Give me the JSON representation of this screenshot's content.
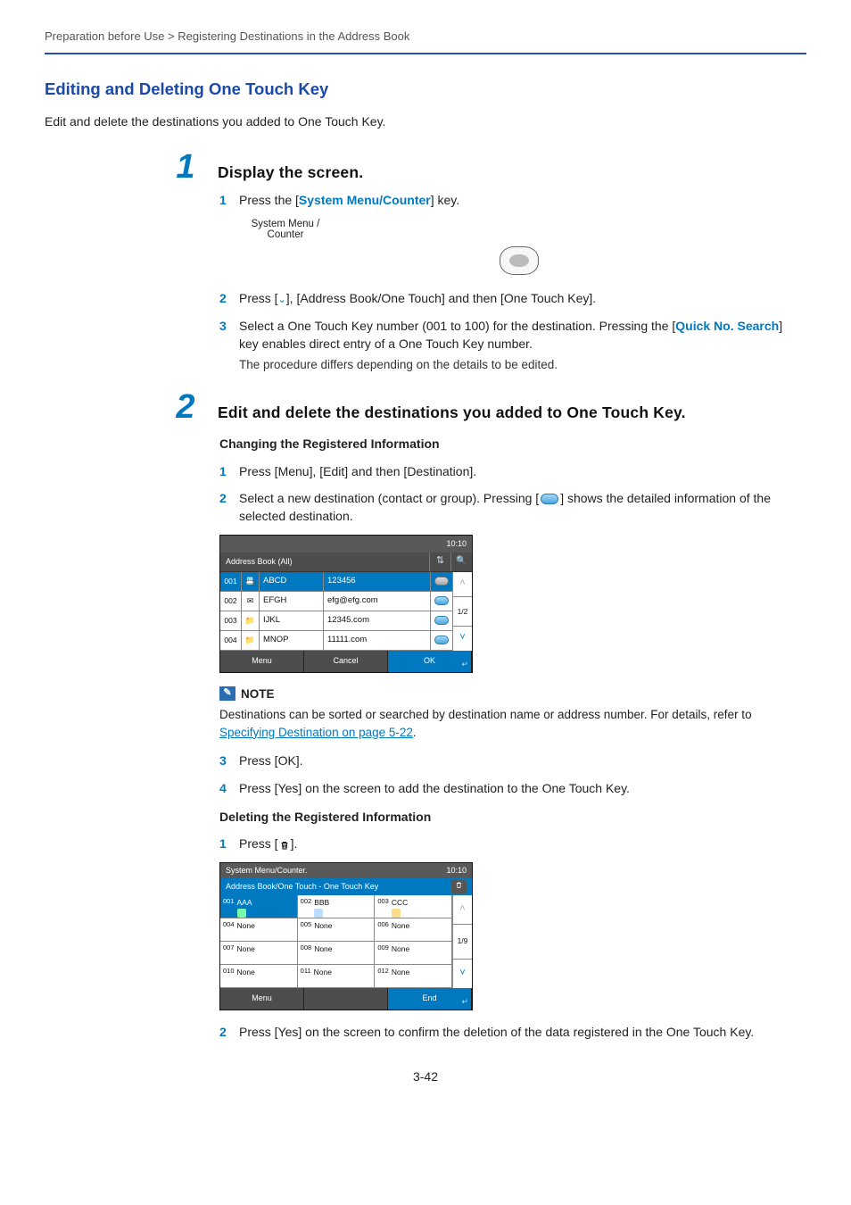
{
  "breadcrumb": "Preparation before Use > Registering Destinations in the Address Book",
  "heading": "Editing and Deleting One Touch Key",
  "intro": "Edit and delete the destinations you added to One Touch Key.",
  "page_number": "3-42",
  "step1": {
    "num": "1",
    "title": "Display the screen.",
    "s1": {
      "num": "1",
      "pre": "Press the [",
      "link": "System Menu/Counter",
      "post": "] key."
    },
    "sysmenu_l1": "System Menu /",
    "sysmenu_l2": "Counter",
    "s2": {
      "num": "2",
      "text_pre": "Press [",
      "text_post": "], [Address Book/One Touch] and then [One Touch Key]."
    },
    "s3": {
      "num": "3",
      "pre": "Select a One Touch Key number (001 to 100) for the destination. Pressing the [",
      "link": "Quick No. Search",
      "post": "] key enables direct entry of a One Touch Key number.",
      "sub": "The procedure differs depending on the details to be edited."
    }
  },
  "step2": {
    "num": "2",
    "title": "Edit and delete the destinations you added to One Touch Key.",
    "sub1": "Changing the Registered Information",
    "c1": {
      "num": "1",
      "text": "Press [Menu], [Edit] and then [Destination]."
    },
    "c2": {
      "num": "2",
      "pre": "Select a new destination (contact or group). Pressing [",
      "post": "] shows the detailed information of the selected destination."
    },
    "screenA": {
      "time": "10:10",
      "title": "Address Book (All)",
      "rows": [
        {
          "idx": "001",
          "name": "ABCD",
          "val": "123456",
          "sel": true
        },
        {
          "idx": "002",
          "name": "EFGH",
          "val": "efg@efg.com",
          "sel": false
        },
        {
          "idx": "003",
          "name": "IJKL",
          "val": "12345.com",
          "sel": false
        },
        {
          "idx": "004",
          "name": "MNOP",
          "val": "11111.com",
          "sel": false
        }
      ],
      "counter": "1/2",
      "menu": "Menu",
      "cancel": "Cancel",
      "ok": "OK"
    },
    "note": {
      "label": "NOTE",
      "pre": "Destinations can be sorted or searched by destination name or address number. For details, refer to ",
      "link": "Specifying Destination on page 5-22",
      "post": "."
    },
    "c3": {
      "num": "3",
      "text": "Press [OK]."
    },
    "c4": {
      "num": "4",
      "text": "Press [Yes] on the screen to add the destination to the One Touch Key."
    },
    "sub2": "Deleting the Registered Information",
    "d1": {
      "num": "1",
      "pre": "Press [",
      "post": "]."
    },
    "screenB": {
      "time": "10:10",
      "crumb": "System Menu/Counter.",
      "title": "Address Book/One Touch - One Touch Key",
      "cells": [
        [
          {
            "idx": "001",
            "text": "AAA",
            "sel": true,
            "icon": "contact"
          },
          {
            "idx": "002",
            "text": "BBB",
            "icon": "group"
          },
          {
            "idx": "003",
            "text": "CCC",
            "icon": "folder"
          }
        ],
        [
          {
            "idx": "004",
            "text": "None"
          },
          {
            "idx": "005",
            "text": "None"
          },
          {
            "idx": "006",
            "text": "None"
          }
        ],
        [
          {
            "idx": "007",
            "text": "None"
          },
          {
            "idx": "008",
            "text": "None"
          },
          {
            "idx": "009",
            "text": "None"
          }
        ],
        [
          {
            "idx": "010",
            "text": "None"
          },
          {
            "idx": "011",
            "text": "None"
          },
          {
            "idx": "012",
            "text": "None"
          }
        ]
      ],
      "counter": "1/9",
      "menu": "Menu",
      "end": "End"
    },
    "d2": {
      "num": "2",
      "text": "Press [Yes] on the screen to confirm the deletion of the data registered in the One Touch Key."
    }
  }
}
